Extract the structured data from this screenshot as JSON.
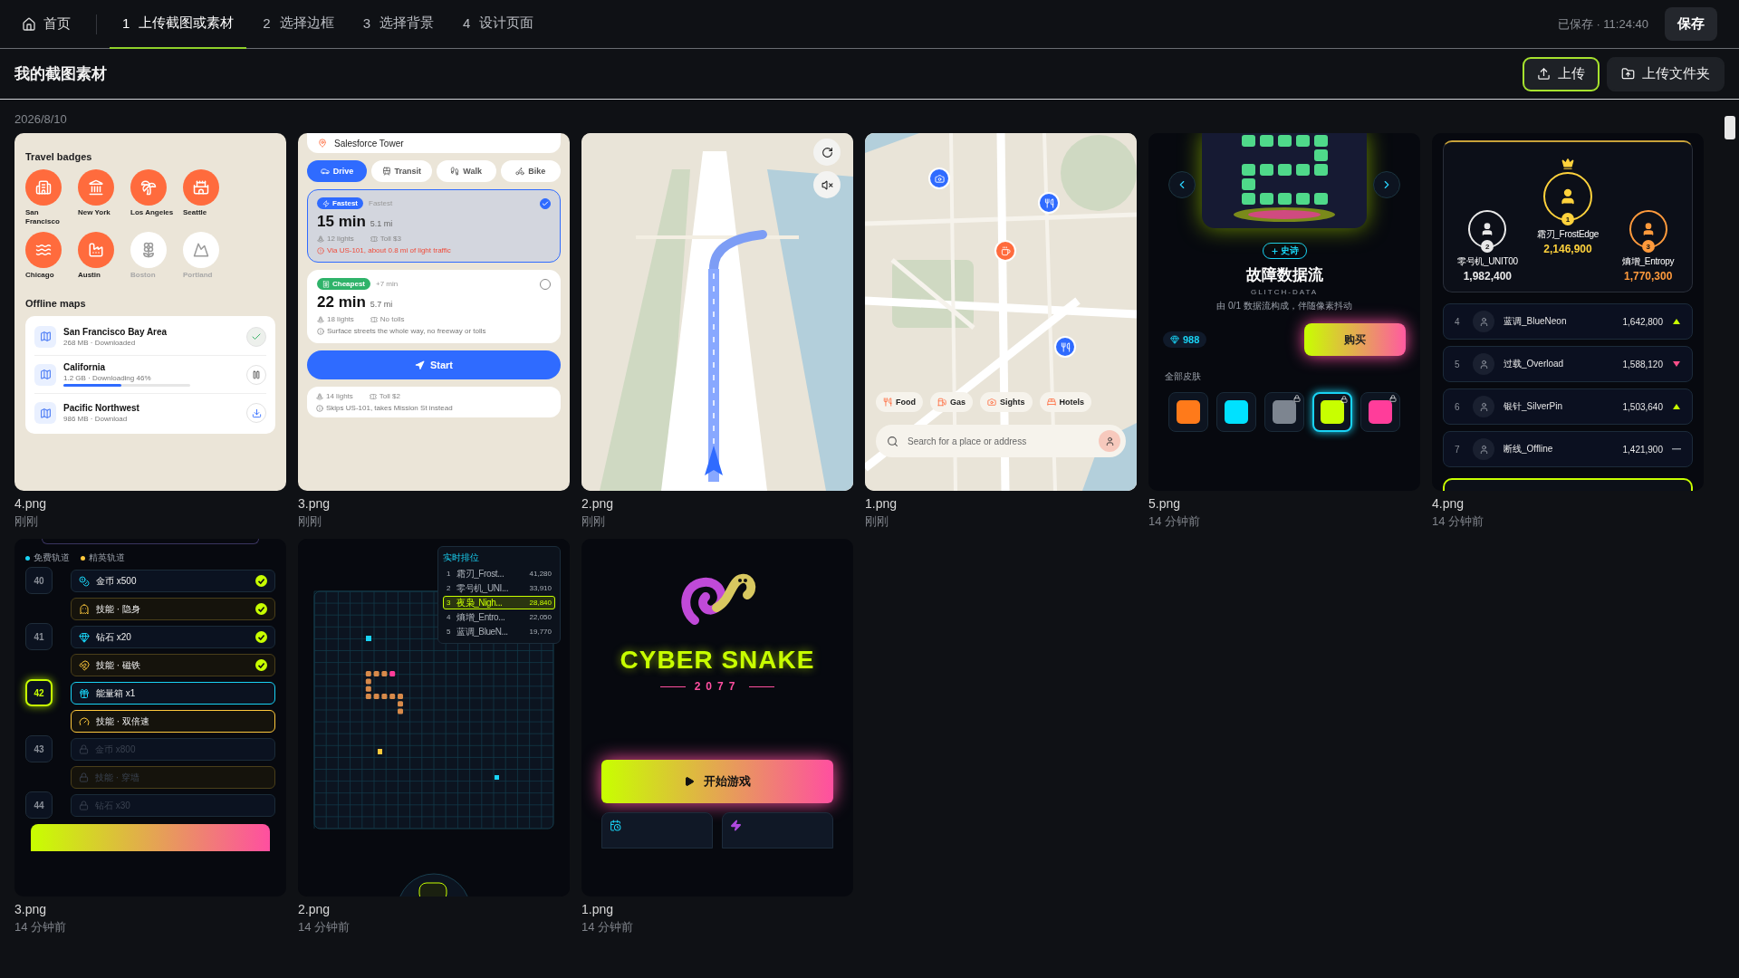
{
  "top_bar": {
    "home": "首页",
    "steps": [
      {
        "number": "1",
        "label": "上传截图或素材",
        "selected": true
      },
      {
        "number": "2",
        "label": "选择边框",
        "selected": false
      },
      {
        "number": "3",
        "label": "选择背景",
        "selected": false
      },
      {
        "number": "4",
        "label": "设计页面",
        "selected": false
      }
    ],
    "saved": "已保存 · 11:24:40",
    "save": "保存"
  },
  "toolbar": {
    "title": "我的截图素材",
    "buttons": [
      {
        "kind": "upload",
        "label": "上传",
        "selected": true
      },
      {
        "kind": "folder",
        "label": "上传文件夹",
        "selected": false
      }
    ]
  },
  "date": "2026/8/10",
  "screenshots": [
    {
      "kind": "travel",
      "file": "4.png",
      "time": "刚刚",
      "heading": "Travel badges",
      "badges": [
        {
          "label": "San Francisco",
          "earned": true
        },
        {
          "label": "New York",
          "earned": true
        },
        {
          "label": "Los Angeles",
          "earned": true
        },
        {
          "label": "Seattle",
          "earned": true
        },
        {
          "label": "Chicago",
          "earned": true
        },
        {
          "label": "Austin",
          "earned": true
        },
        {
          "label": "Boston",
          "earned": false
        },
        {
          "label": "Portland",
          "earned": false
        }
      ],
      "offline_heading": "Offline maps",
      "maps": [
        {
          "kind": "downloaded",
          "name": "San Francisco Bay Area",
          "info": "268 MB · Downloaded"
        },
        {
          "kind": "downloading",
          "name": "California",
          "info": "1.2 GB · Downloading 46%",
          "level": 0.46
        },
        {
          "kind": "available",
          "name": "Pacific Northwest",
          "info": "986 MB · Download"
        }
      ]
    },
    {
      "kind": "routes",
      "file": "3.png",
      "time": "刚刚",
      "destination": "Salesforce Tower",
      "modes": [
        {
          "label": "Drive",
          "selected": true
        },
        {
          "label": "Transit",
          "selected": false
        },
        {
          "label": "Walk",
          "selected": false
        },
        {
          "label": "Bike",
          "selected": false
        }
      ],
      "routes": [
        {
          "tag": "Fastest",
          "extra": "Fastest",
          "duration": "15 min",
          "distance": "5.1 mi",
          "lights": "12 lights",
          "toll": "Toll $3",
          "note": "Via US-101, about 0.8 mi of light traffic",
          "warning": true,
          "selected": true
        },
        {
          "tag": "Cheapest",
          "extra": "+7 min",
          "duration": "22 min",
          "distance": "5.7 mi",
          "lights": "18 lights",
          "toll": "No tolls",
          "note": "Surface streets the whole way, no freeway or tolls",
          "warning": false,
          "selected": false
        }
      ],
      "hidden_route": {
        "lights": "14 lights",
        "toll": "Toll $2",
        "note": "Skips US-101, takes Mission St instead"
      },
      "start": "Start"
    },
    {
      "kind": "navigation",
      "file": "2.png",
      "time": "刚刚"
    },
    {
      "kind": "map",
      "file": "1.png",
      "time": "刚刚",
      "categories": [
        "Food",
        "Gas",
        "Sights",
        "Hotels"
      ],
      "placeholder": "Search for a place or address"
    },
    {
      "kind": "skin",
      "file": "5.png",
      "time": "14 分钟前",
      "rarity": "史诗",
      "name": "故障数据流",
      "code": "GLITCH-DATA",
      "description": "由 0/1 数据流构成，伴随像素抖动",
      "gems": "988",
      "buy": "购买",
      "all_label": "全部皮肤",
      "skins": [
        {
          "color": "#ff7a1a",
          "locked": false,
          "selected": false
        },
        {
          "color": "#00e1ff",
          "locked": false,
          "selected": false
        },
        {
          "color": "#7d8590",
          "locked": true,
          "selected": false
        },
        {
          "color": "#c8ff00",
          "locked": true,
          "selected": true
        },
        {
          "color": "#ff3d9a",
          "locked": true,
          "selected": false
        }
      ]
    },
    {
      "kind": "leaderboard",
      "file": "4.png",
      "time": "14 分钟前",
      "podium": [
        {
          "rank": "2",
          "name": "零号机_UNIT00",
          "score": "1,982,400"
        },
        {
          "rank": "1",
          "name": "霜刃_FrostEdge",
          "score": "2,146,900"
        },
        {
          "rank": "3",
          "name": "熵增_Entropy",
          "score": "1,770,300"
        }
      ],
      "rows": [
        {
          "kind": "up",
          "rank": "4",
          "name": "蓝调_BlueNeon",
          "score": "1,642,800"
        },
        {
          "kind": "down",
          "rank": "5",
          "name": "过载_Overload",
          "score": "1,588,120"
        },
        {
          "kind": "up",
          "rank": "6",
          "name": "银针_SilverPin",
          "score": "1,503,640"
        },
        {
          "kind": "flat",
          "rank": "7",
          "name": "断线_Offline",
          "score": "1,421,900"
        }
      ]
    },
    {
      "kind": "pass",
      "file": "3.png",
      "time": "14 分钟前",
      "legend": [
        {
          "label": "免费轨道",
          "color": "#19d3f5"
        },
        {
          "label": "精英轨道",
          "color": "#ffc93c"
        }
      ],
      "levels": [
        {
          "level": "40",
          "current": false,
          "rewards": [
            {
              "kind": "free",
              "label": "金币 x500",
              "claimed": true,
              "locked": false
            },
            {
              "kind": "elite",
              "label": "技能 · 隐身",
              "claimed": true,
              "locked": false
            }
          ]
        },
        {
          "level": "41",
          "current": false,
          "rewards": [
            {
              "kind": "free",
              "label": "钻石 x20",
              "claimed": true,
              "locked": false
            },
            {
              "kind": "elite",
              "label": "技能 · 磁铁",
              "claimed": true,
              "locked": false
            }
          ]
        },
        {
          "level": "42",
          "current": true,
          "rewards": [
            {
              "kind": "free",
              "label": "能量箱 x1",
              "claimed": false,
              "locked": false
            },
            {
              "kind": "elite",
              "label": "技能 · 双倍速",
              "claimed": false,
              "locked": false
            }
          ]
        },
        {
          "level": "43",
          "current": false,
          "rewards": [
            {
              "kind": "free",
              "label": "金币 x800",
              "claimed": false,
              "locked": true
            },
            {
              "kind": "elite",
              "label": "技能 · 穿墙",
              "claimed": false,
              "locked": true
            }
          ]
        },
        {
          "level": "44",
          "current": false,
          "rewards": [
            {
              "kind": "free",
              "label": "钻石 x30",
              "claimed": false,
              "locked": true
            }
          ]
        }
      ]
    },
    {
      "kind": "game",
      "file": "2.png",
      "time": "14 分钟前",
      "ranking_title": "实时排位",
      "ranking": [
        {
          "rank": "1",
          "name": "霜刃_Frost...",
          "score": "41,280",
          "selected": false
        },
        {
          "rank": "2",
          "name": "零号机_UNI...",
          "score": "33,910",
          "selected": false
        },
        {
          "rank": "3",
          "name": "夜枭_Nigh...",
          "score": "28,840",
          "selected": true
        },
        {
          "rank": "4",
          "name": "熵增_Entro...",
          "score": "22,050",
          "selected": false
        },
        {
          "rank": "5",
          "name": "蓝调_BlueN...",
          "score": "19,770",
          "selected": false
        }
      ]
    },
    {
      "kind": "title",
      "file": "1.png",
      "time": "14 分钟前",
      "title": "CYBER SNAKE",
      "year": "2077",
      "play": "开始游戏"
    }
  ]
}
